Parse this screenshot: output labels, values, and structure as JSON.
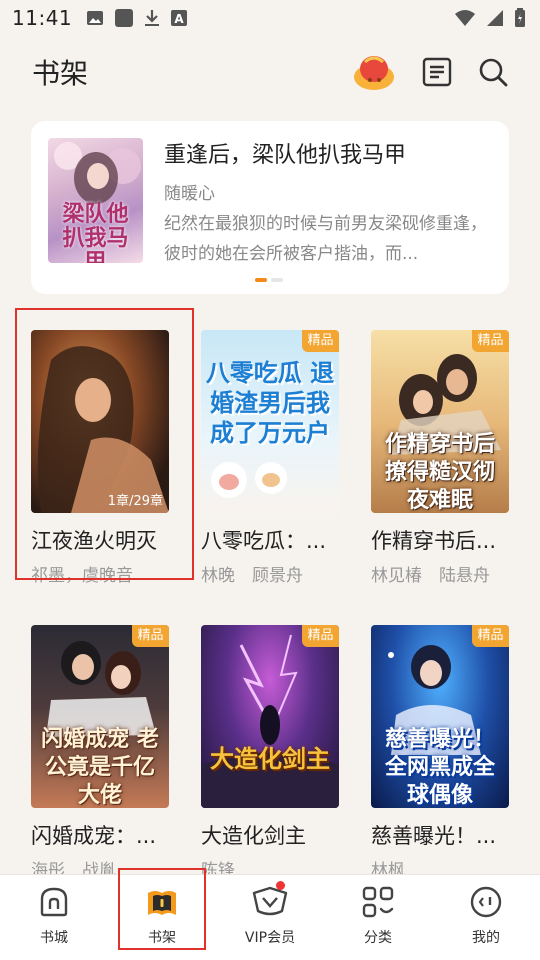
{
  "status_bar": {
    "time": "11:41"
  },
  "header": {
    "title": "书架"
  },
  "featured": {
    "title": "重逢后，梁队他扒我马甲",
    "author": "随暖心",
    "description": "纪然在最狼狈的时候与前男友梁砚修重逢，彼时的她在会所被客户揩油，而...",
    "cover_text": "梁队他扒我马甲",
    "dots": 2,
    "active_dot": 0
  },
  "books": [
    {
      "title": "江夜渔火明灭",
      "authors": "祁墨，虞晚音",
      "progress": "1章/29章",
      "badge": "",
      "cover_text": ""
    },
    {
      "title": "八零吃瓜：...",
      "authors": "林晚　顾景舟",
      "progress": "",
      "badge": "精品",
      "cover_text": "八零吃瓜 退婚渣男后我成了万元户"
    },
    {
      "title": "作精穿书后...",
      "authors": "林见椿　陆悬舟",
      "progress": "",
      "badge": "精品",
      "cover_text": "作精穿书后 撩得糙汉彻夜难眠"
    },
    {
      "title": "闪婚成宠：...",
      "authors": "海彤　战胤",
      "progress": "",
      "badge": "精品",
      "cover_text": "闪婚成宠 老公竟是千亿大佬"
    },
    {
      "title": "大造化剑主",
      "authors": "陈锋",
      "progress": "",
      "badge": "精品",
      "cover_text": "大造化剑主"
    },
    {
      "title": "慈善曝光！...",
      "authors": "林枫",
      "progress": "",
      "badge": "精品",
      "cover_text": "慈善曝光！全网黑成全球偶像"
    }
  ],
  "tabs": [
    {
      "label": "书城",
      "icon": "store-icon"
    },
    {
      "label": "书架",
      "icon": "bookshelf-icon",
      "active": true
    },
    {
      "label": "VIP会员",
      "icon": "vip-icon",
      "dot": true
    },
    {
      "label": "分类",
      "icon": "category-icon"
    },
    {
      "label": "我的",
      "icon": "profile-icon"
    }
  ],
  "colors": {
    "accent": "#f28a1c",
    "badge": "#f2a530",
    "highlight": "#e0322d",
    "background": "#f6f3ef"
  }
}
